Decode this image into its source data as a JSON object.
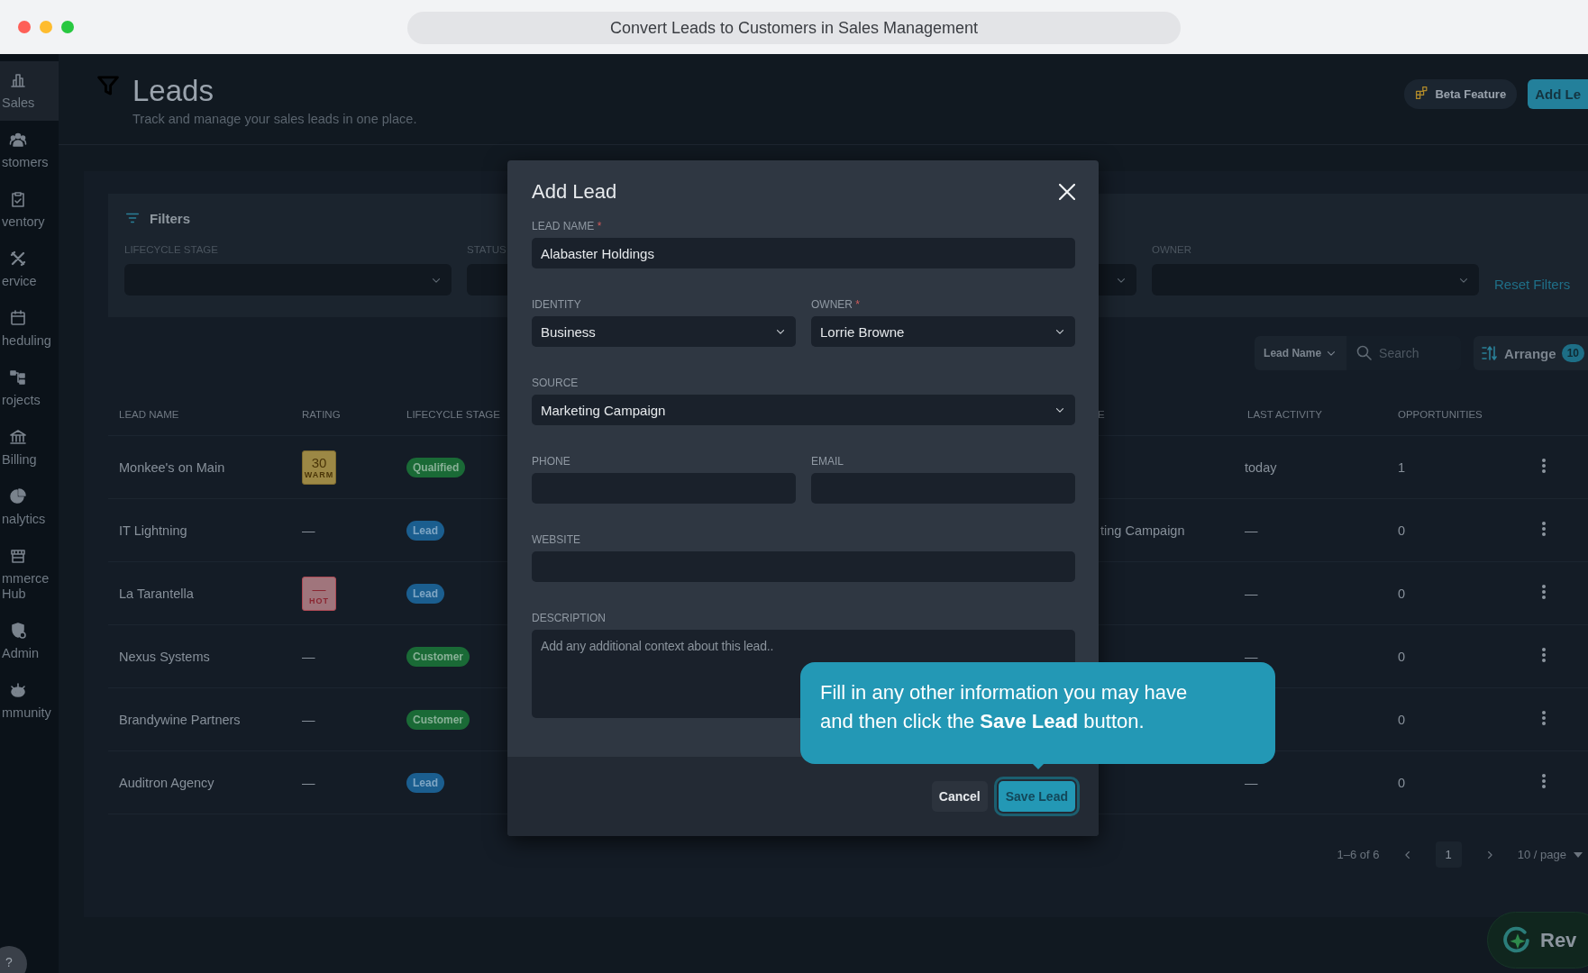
{
  "window": {
    "title": "Convert Leads to Customers in Sales Management"
  },
  "sidebar": {
    "items": [
      {
        "label": "Sales",
        "selected": true
      },
      {
        "label": "stomers",
        "selected": false
      },
      {
        "label": "ventory",
        "selected": false
      },
      {
        "label": "ervice",
        "selected": false
      },
      {
        "label": "heduling",
        "selected": false
      },
      {
        "label": "rojects",
        "selected": false
      },
      {
        "label": "Billing",
        "selected": false
      },
      {
        "label": "nalytics",
        "selected": false
      },
      {
        "label": "mmerce Hub",
        "selected": false
      },
      {
        "label": "Admin",
        "selected": false
      },
      {
        "label": "mmunity",
        "selected": false
      }
    ],
    "help_button": "?"
  },
  "header": {
    "title": "Leads",
    "subtitle": "Track and manage your sales leads in one place.",
    "beta_badge": "Beta Feature",
    "add_button": "Add Le"
  },
  "filters": {
    "title": "Filters",
    "fields": [
      {
        "kind": "select",
        "label": "LIFECYCLE STAGE"
      },
      {
        "kind": "select",
        "label": "STATUS"
      },
      {
        "kind": "select"
      },
      {
        "kind": "select",
        "label": "OWNER"
      }
    ],
    "reset": "Reset Filters"
  },
  "toolbar": {
    "sort_field": "Lead Name",
    "search_placeholder": "Search",
    "arrange": "Arrange",
    "arrange_count": "10"
  },
  "table": {
    "columns": [
      "LEAD NAME",
      "RATING",
      "LIFECYCLE STAGE",
      "E",
      "LAST ACTIVITY",
      "OPPORTUNITIES"
    ],
    "rows": [
      {
        "name": "Monkee's on Main",
        "rating": {
          "kind": "warm",
          "score": "30",
          "label": "WARM"
        },
        "stage": {
          "label": "Qualified",
          "kind": "qualified"
        },
        "last_activity": "today",
        "opportunities": "1"
      },
      {
        "name": "IT Lightning",
        "rating": {
          "kind": "none",
          "text": "—"
        },
        "stage": {
          "label": "Lead",
          "kind": "lead"
        },
        "column_4": "ting Campaign",
        "last_activity": "—",
        "opportunities": "0"
      },
      {
        "name": "La Tarantella",
        "rating": {
          "kind": "hot",
          "score": "—",
          "label": "HOT"
        },
        "stage": {
          "label": "Lead",
          "kind": "lead"
        },
        "last_activity": "—",
        "opportunities": "0"
      },
      {
        "name": "Nexus Systems",
        "rating": {
          "kind": "none",
          "text": "—"
        },
        "stage": {
          "label": "Customer",
          "kind": "customer"
        },
        "last_activity": "—",
        "opportunities": "0"
      },
      {
        "name": "Brandywine Partners",
        "rating": {
          "kind": "none",
          "text": "—"
        },
        "stage": {
          "label": "Customer",
          "kind": "customer"
        },
        "opportunities": "0"
      },
      {
        "name": "Auditron Agency",
        "rating": {
          "kind": "none",
          "text": "—"
        },
        "stage": {
          "label": "Lead",
          "kind": "lead"
        },
        "last_activity": "—",
        "opportunities": "0"
      }
    ]
  },
  "pagination": {
    "range": "1–6 of 6",
    "pages": [
      {
        "label": "1",
        "selected": true
      }
    ],
    "page_size": "10 / page"
  },
  "assistant_button": "Rev",
  "modal": {
    "title": "Add Lead",
    "rows": [
      [
        {
          "kind": "text",
          "label": "LEAD NAME",
          "required_mark": "*",
          "value": "Alabaster Holdings"
        }
      ],
      [
        {
          "kind": "select",
          "label": "IDENTITY",
          "value": "Business"
        },
        {
          "kind": "select",
          "label": "OWNER",
          "required_mark": "*",
          "value": "Lorrie Browne"
        }
      ],
      [
        {
          "kind": "select",
          "label": "SOURCE",
          "value": "Marketing Campaign"
        }
      ],
      [
        {
          "kind": "text",
          "label": "PHONE"
        },
        {
          "kind": "text",
          "label": "EMAIL"
        }
      ],
      [
        {
          "kind": "text",
          "label": "WEBSITE"
        }
      ],
      [
        {
          "kind": "textarea",
          "label": "DESCRIPTION",
          "placeholder": "Add any additional context about this lead.."
        }
      ]
    ],
    "buttons": [
      {
        "label": "Cancel",
        "kind": "secondary",
        "highlighted": false
      },
      {
        "label": "Save Lead",
        "kind": "primary",
        "highlighted": true
      }
    ]
  },
  "tooltip": {
    "text": "Fill in any other information you may have and then click the **Save Lead** button."
  }
}
